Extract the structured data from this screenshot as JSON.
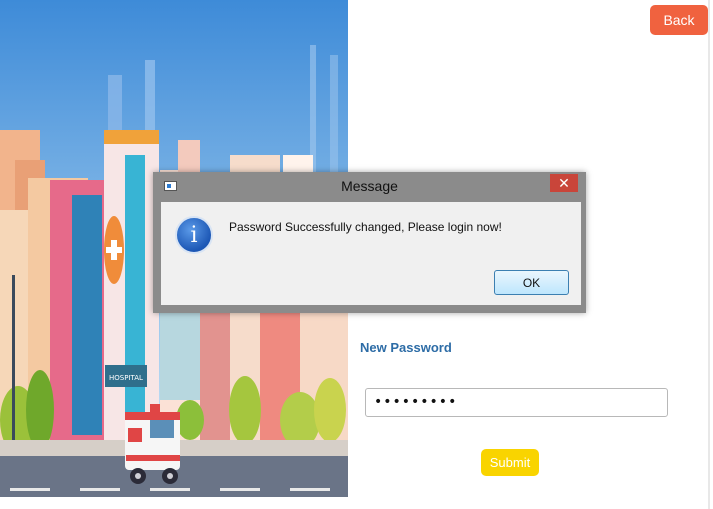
{
  "header": {
    "back_label": "Back"
  },
  "form": {
    "new_password_label": "New Password",
    "password_value": "•••••••••",
    "submit_label": "Submit"
  },
  "dialog": {
    "title": "Message",
    "close_glyph": "✕",
    "info_glyph": "i",
    "message": "Password Successfully changed, Please login now!",
    "ok_label": "OK"
  },
  "illustration": {
    "sign_text": "HOSPITAL"
  },
  "colors": {
    "back_button": "#f0623f",
    "submit_button": "#f9d400",
    "label_blue": "#2d6ca6",
    "dialog_close": "#c9453a"
  }
}
